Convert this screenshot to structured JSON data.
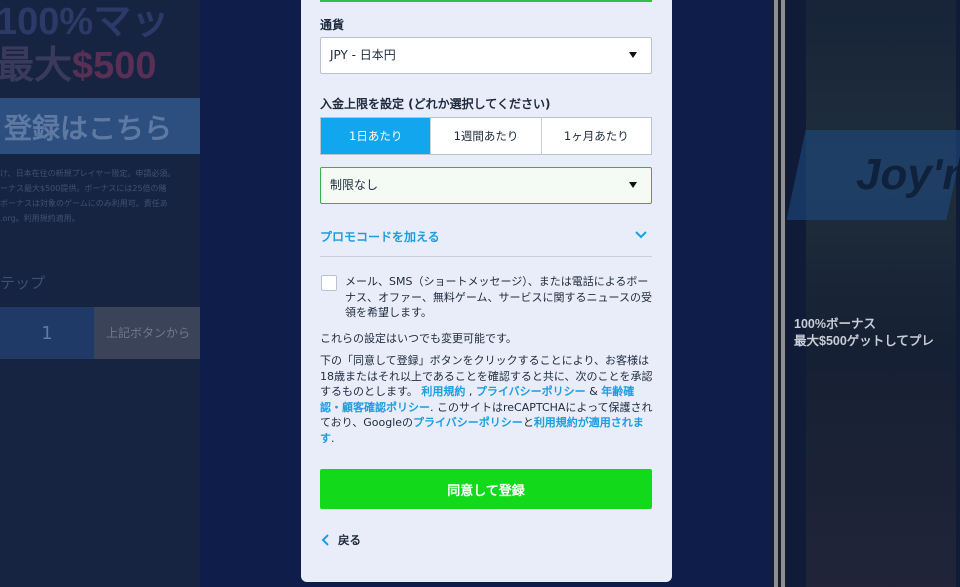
{
  "background": {
    "hero_line1": "100%マッ",
    "hero_line2_prefix": "最大",
    "hero_line2_accent": "$500",
    "register_banner": "登録はこちら",
    "terms_lines": [
      "け、日本在住の新規プレイヤー限定。申請必須。",
      "ーナス最大$500提供。ボーナスには25倍の賭",
      "ボーナスは対象のゲームにのみ利用可。責任あ",
      ".org。利用規約適用。"
    ],
    "step_label": "テップ",
    "step_number": "1",
    "step_desc": "上記ボタンから",
    "right_promo_line1": "100%ボーナス",
    "right_promo_line2": "最大$500ゲットしてプレ",
    "right_logo": "Joy'n"
  },
  "form": {
    "currency_label": "通貨",
    "currency_value": "JPY - 日本円",
    "deposit_limit_label": "入金上限を設定 (どれか選択してください)",
    "period_tabs": [
      "1日あたり",
      "1週間あたり",
      "1ヶ月あたり"
    ],
    "active_tab_index": 0,
    "limit_value": "制限なし",
    "promo_code_label": "プロモコードを加える",
    "marketing_consent_checked": false,
    "marketing_consent_text": "メール、SMS（ショートメッセージ）、または電話によるボーナス、オファー、無料ゲーム、サービスに関するニュースの受領を希望します。",
    "settings_note": "これらの設定はいつでも変更可能です。",
    "legal_text_1": "下の「同意して登録」ボタンをクリックすることにより、お客様は18歳またはそれ以上であることを確認すると共に、次のことを承認するものとします。",
    "link_terms": "利用規約",
    "sep_comma": ",",
    "link_privacy": "プライバシーポリシー",
    "sep_amp": "&",
    "link_age": "年齢確認・顧客確認ポリシー",
    "legal_text_2": ". このサイトはreCAPTCHAによって保護されており、Googleの",
    "link_google_privacy": "プライバシーポリシー",
    "legal_text_3": "と",
    "link_google_terms": "利用規約が適用されます",
    "legal_end": ".",
    "submit_label": "同意して登録",
    "back_label": "戻る"
  },
  "colors": {
    "accent_blue": "#12a6ef",
    "link_blue": "#1c9ee0",
    "cta_green": "#12d91a",
    "panel_bg": "#e8edf9"
  },
  "icons": {
    "dropdown": "triangle-down-icon",
    "promo_toggle": "chevron-down-icon",
    "back": "chevron-left-icon"
  }
}
